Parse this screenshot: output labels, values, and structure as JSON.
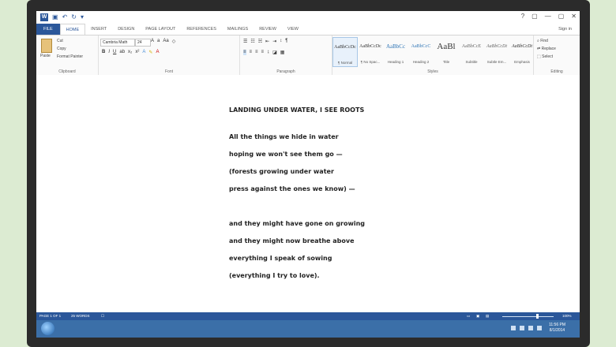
{
  "titlebar": {
    "logo": "W",
    "help": "?",
    "restore": "▢",
    "minimize": "—",
    "close": "✕"
  },
  "tabs": [
    "FILE",
    "HOME",
    "INSERT",
    "DESIGN",
    "PAGE LAYOUT",
    "REFERENCES",
    "MAILINGS",
    "REVIEW",
    "VIEW"
  ],
  "signin": "Sign in",
  "ribbon": {
    "clipboard": {
      "paste": "Paste",
      "cut": "Cut",
      "copy": "Copy",
      "format_painter": "Format Painter",
      "label": "Clipboard"
    },
    "font": {
      "name": "Cambria Math",
      "size": "24",
      "bold": "B",
      "italic": "I",
      "underline": "U",
      "label": "Font"
    },
    "paragraph": {
      "label": "Paragraph"
    },
    "styles": {
      "items": [
        {
          "preview": "AaBbCcDc",
          "name": "¶ Normal"
        },
        {
          "preview": "AaBbCcDc",
          "name": "¶ No Spac..."
        },
        {
          "preview": "AaBbCc",
          "name": "Heading 1"
        },
        {
          "preview": "AaBbCcC",
          "name": "Heading 2"
        },
        {
          "preview": "AaBl",
          "name": "Title"
        },
        {
          "preview": "AaBbCcE",
          "name": "Subtitle"
        },
        {
          "preview": "AaBbCcDt",
          "name": "Subtle Em..."
        },
        {
          "preview": "AaBbCcDt",
          "name": "Emphasis"
        }
      ],
      "label": "Styles"
    },
    "editing": {
      "find": "Find",
      "replace": "Replace",
      "select": "Select",
      "label": "Editing"
    }
  },
  "document": {
    "title": "LANDING UNDER WATER, I SEE ROOTS",
    "stanza1": [
      "All the things we hide in water",
      "hoping we won't see them go —",
      "(forests growing under water",
      "press against the ones we know) —"
    ],
    "stanza2": [
      "and they might have gone on growing",
      "and they might now breathe above",
      "everything I speak of sowing",
      "(everything I try to love)."
    ]
  },
  "status": {
    "page": "PAGE 1 OF 1",
    "words": "25 WORDS",
    "zoom": "100%"
  },
  "taskbar": {
    "time": "11:56 PM",
    "date": "8/1/2014"
  },
  "colors": {
    "accent": "#2b579a",
    "taskbar": "#3b6fa8"
  }
}
